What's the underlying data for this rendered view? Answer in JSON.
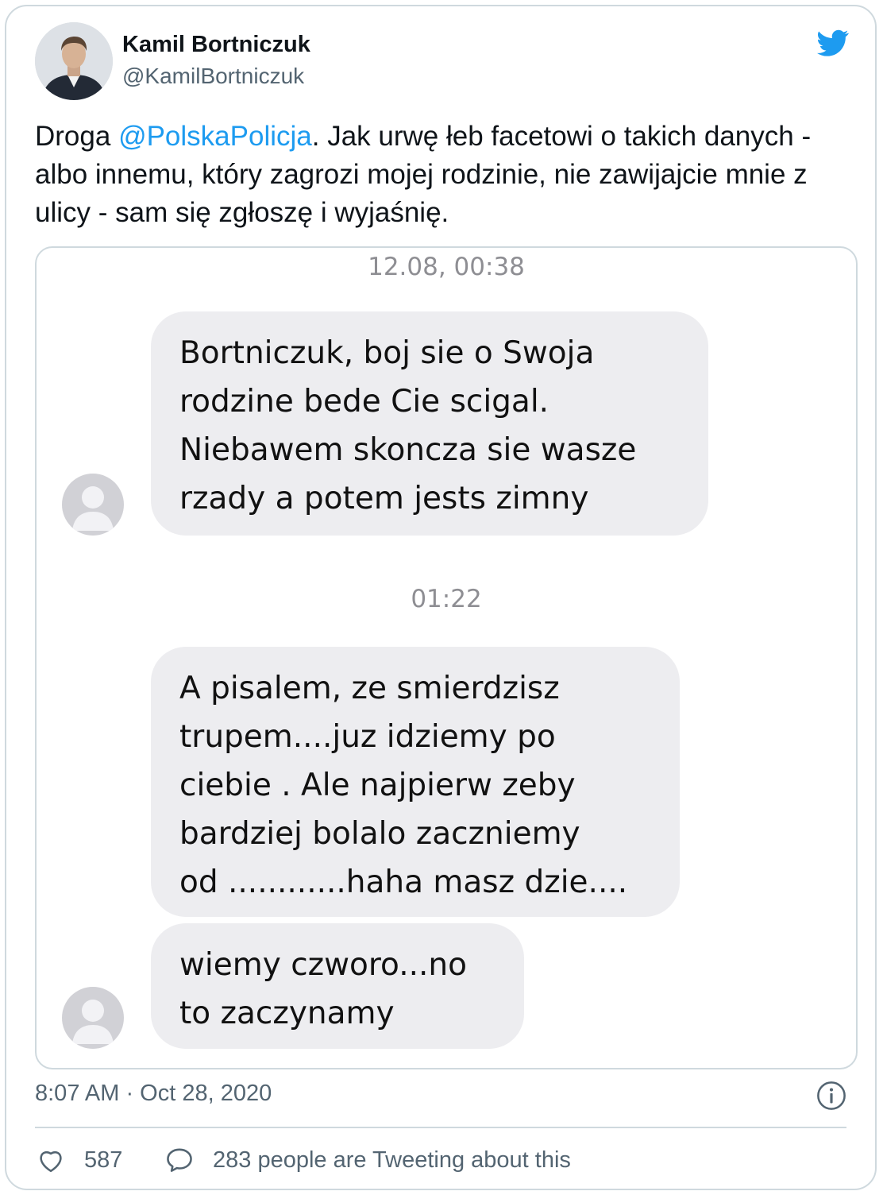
{
  "author": {
    "name": "Kamil Bortniczuk",
    "handle": "@KamilBortniczuk"
  },
  "tweet": {
    "text_prefix": "Droga ",
    "mention": "@PolskaPolicja",
    "text_suffix": ". Jak urwę łeb facetowi o takich danych - albo innemu, który zagrozi mojej rodzinie, nie zawijajcie mnie z ulicy - sam się zgłoszę i wyjaśnię."
  },
  "screenshot": {
    "time_1": "12.08, 00:38",
    "message_1": "Bortniczuk, boj sie o Swoja\nrodzine  bede Cie scigal.\nNiebawem skoncza sie wasze\nrzady a potem jests zimny",
    "time_2": "01:22",
    "message_2": "A pisalem, ze smierdzisz\ntrupem....juz idziemy po\nciebie . Ale najpierw zeby\nbardziej bolalo zaczniemy\nod ............haha masz dzie....",
    "message_3": "wiemy czworo...no\nto zaczynamy"
  },
  "meta": {
    "timestamp": "8:07 AM · Oct 28, 2020",
    "likes": "587",
    "conversation": "283 people are Tweeting about this"
  },
  "icons": {
    "brand": "twitter-bird-icon",
    "info": "info-icon",
    "like": "heart-icon",
    "reply": "speech-bubble-icon"
  },
  "colors": {
    "accent": "#1d9bf0",
    "text": "#0f1419",
    "muted": "#536471",
    "border": "#cfd9de",
    "bubble": "#ededf0"
  }
}
